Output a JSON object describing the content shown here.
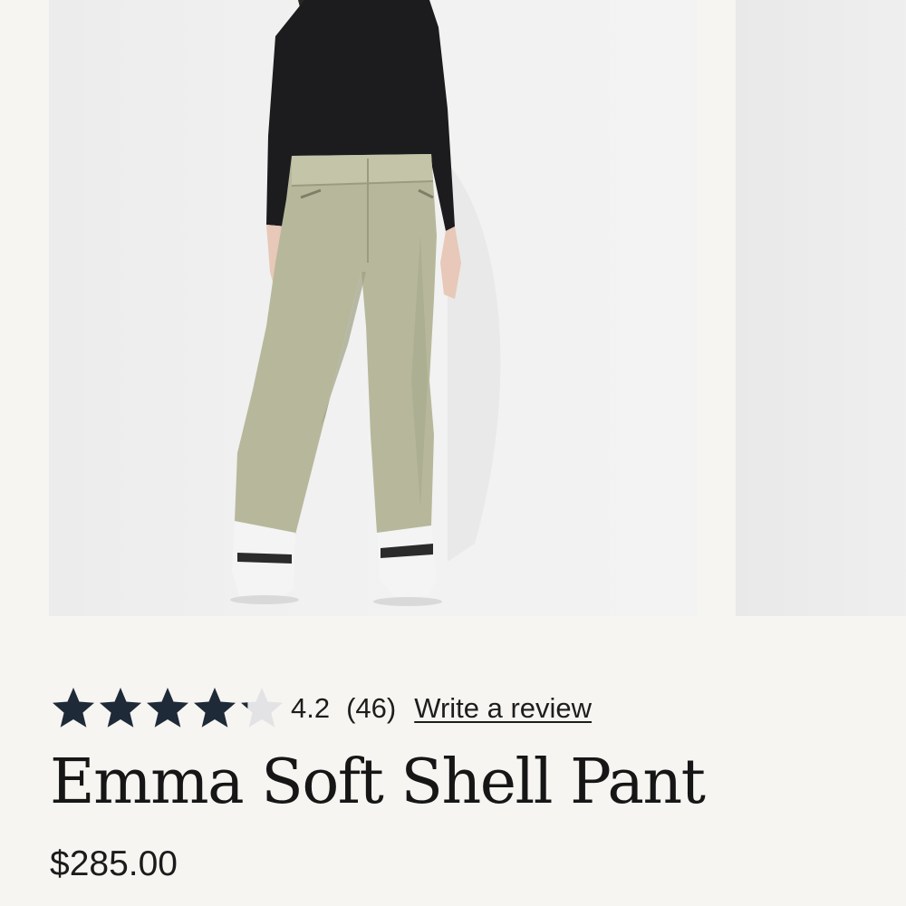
{
  "product": {
    "title": "Emma Soft Shell Pant",
    "price": "$285.00",
    "rating": {
      "value": 4.2,
      "value_label": "4.2",
      "max": 5,
      "count_label": "(46)",
      "write_review_label": "Write a review"
    }
  },
  "gallery": {
    "main_image": "product-photo-model-in-pants",
    "next_image": "product-photo-next"
  },
  "colors": {
    "background": "#f6f5f1",
    "star_filled": "#1f2a38",
    "star_empty": "#e3e3e5",
    "pant_color": "#b7b89b"
  },
  "icons": {
    "star": "star-icon"
  }
}
